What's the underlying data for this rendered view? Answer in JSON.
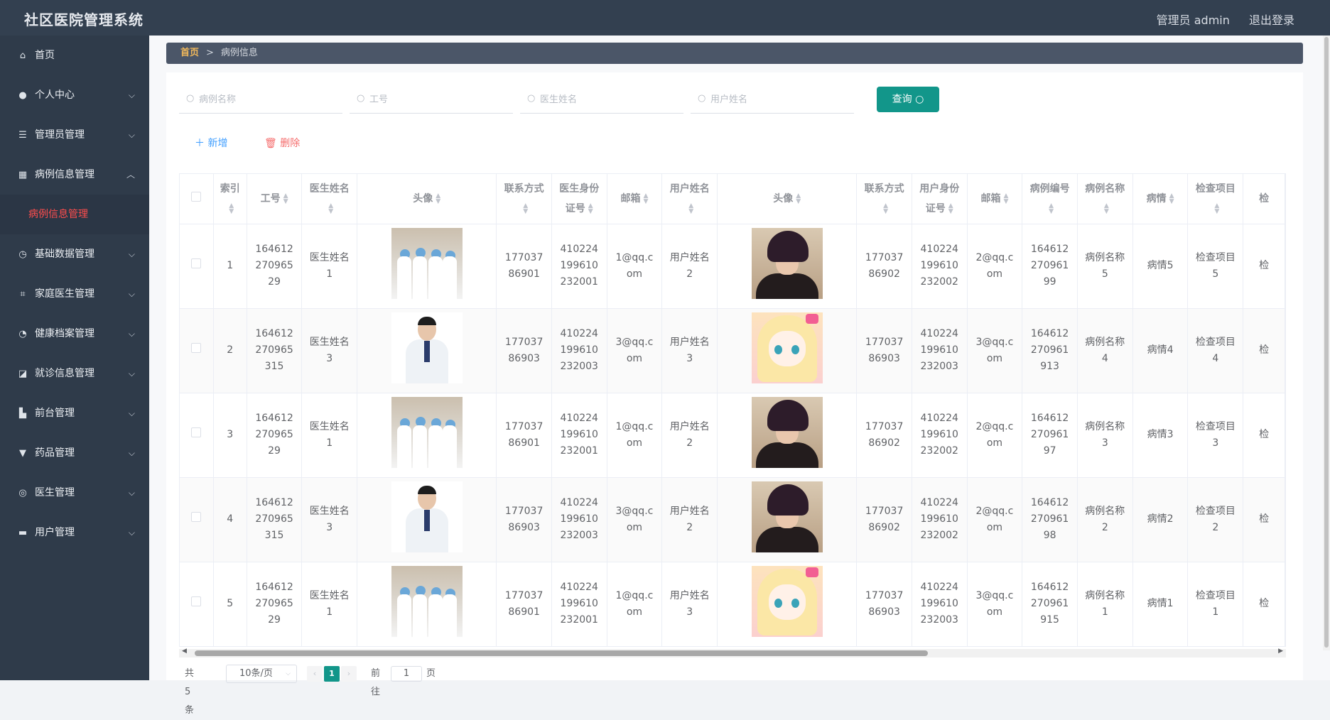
{
  "header": {
    "title": "社区医院管理系统",
    "user_label": "管理员 admin",
    "logout_label": "退出登录"
  },
  "sidebar": {
    "items": [
      {
        "icon": "home-icon",
        "label": "首页"
      },
      {
        "icon": "user-icon",
        "label": "个人中心"
      },
      {
        "icon": "list-icon",
        "label": "管理员管理"
      },
      {
        "icon": "grid-icon",
        "label": "病例信息管理",
        "expanded": true
      },
      {
        "icon": "clock-icon",
        "label": "基础数据管理"
      },
      {
        "icon": "crop-icon",
        "label": "家庭医生管理"
      },
      {
        "icon": "compass-icon",
        "label": "健康档案管理"
      },
      {
        "icon": "chart-icon",
        "label": "就诊信息管理"
      },
      {
        "icon": "desk-icon",
        "label": "前台管理"
      },
      {
        "icon": "cup-icon",
        "label": "药品管理"
      },
      {
        "icon": "target-icon",
        "label": "医生管理"
      },
      {
        "icon": "monitor-icon",
        "label": "用户管理"
      }
    ],
    "sub_active": "病例信息管理"
  },
  "breadcrumb": {
    "home": "首页",
    "separator": ">",
    "current": "病例信息"
  },
  "search": {
    "placeholders": [
      "病例名称",
      "工号",
      "医生姓名",
      "用户姓名"
    ],
    "query_label": "查询"
  },
  "actions": {
    "add_label": "新增",
    "delete_label": "删除"
  },
  "table": {
    "headers": [
      "索引",
      "工号",
      "医生姓名",
      "头像",
      "联系方式",
      "医生身份证号",
      "邮箱",
      "用户姓名",
      "头像",
      "联系方式",
      "用户身份证号",
      "邮箱",
      "病例编号",
      "病例名称",
      "病情",
      "检查项目",
      "检"
    ],
    "rows": [
      [
        "1",
        "16461227096529",
        "医生姓名1",
        "doctor-group-photo",
        "17703786901",
        "410224199610232001",
        "1@qq.com",
        "用户姓名2",
        "user-male-photo",
        "17703786902",
        "410224199610232002",
        "2@qq.com",
        "16461227096199",
        "病例名称5",
        "病情5",
        "检查项目5",
        "检"
      ],
      [
        "2",
        "164612270965315",
        "医生姓名3",
        "doctor-single-photo",
        "17703786903",
        "410224199610232003",
        "3@qq.com",
        "用户姓名3",
        "user-anime-photo",
        "17703786903",
        "410224199610232003",
        "3@qq.com",
        "164612270961913",
        "病例名称4",
        "病情4",
        "检查项目4",
        "检"
      ],
      [
        "3",
        "16461227096529",
        "医生姓名1",
        "doctor-group-photo",
        "17703786901",
        "410224199610232001",
        "1@qq.com",
        "用户姓名2",
        "user-male-photo",
        "17703786902",
        "410224199610232002",
        "2@qq.com",
        "16461227096197",
        "病例名称3",
        "病情3",
        "检查项目3",
        "检"
      ],
      [
        "4",
        "164612270965315",
        "医生姓名3",
        "doctor-single-photo",
        "17703786903",
        "410224199610232003",
        "3@qq.com",
        "用户姓名2",
        "user-male-photo",
        "17703786902",
        "410224199610232002",
        "2@qq.com",
        "16461227096198",
        "病例名称2",
        "病情2",
        "检查项目2",
        "检"
      ],
      [
        "5",
        "16461227096529",
        "医生姓名1",
        "doctor-group-photo",
        "17703786901",
        "410224199610232001",
        "1@qq.com",
        "用户姓名3",
        "user-anime-photo",
        "17703786903",
        "410224199610232003",
        "3@qq.com",
        "164612270961915",
        "病例名称1",
        "病情1",
        "检查项目1",
        "检"
      ]
    ]
  },
  "pagination": {
    "total_label": "共 5 条",
    "page_size_label": "10条/页",
    "current_page": "1",
    "goto_prefix": "前往",
    "goto_value": "1",
    "goto_suffix": "页"
  },
  "colors": {
    "topbar": "#334050",
    "sidebar": "#2f3b4a",
    "accent": "#12968a",
    "active_sub": "#ff4d4d",
    "add": "#409eff",
    "delete": "#f56c6c"
  }
}
